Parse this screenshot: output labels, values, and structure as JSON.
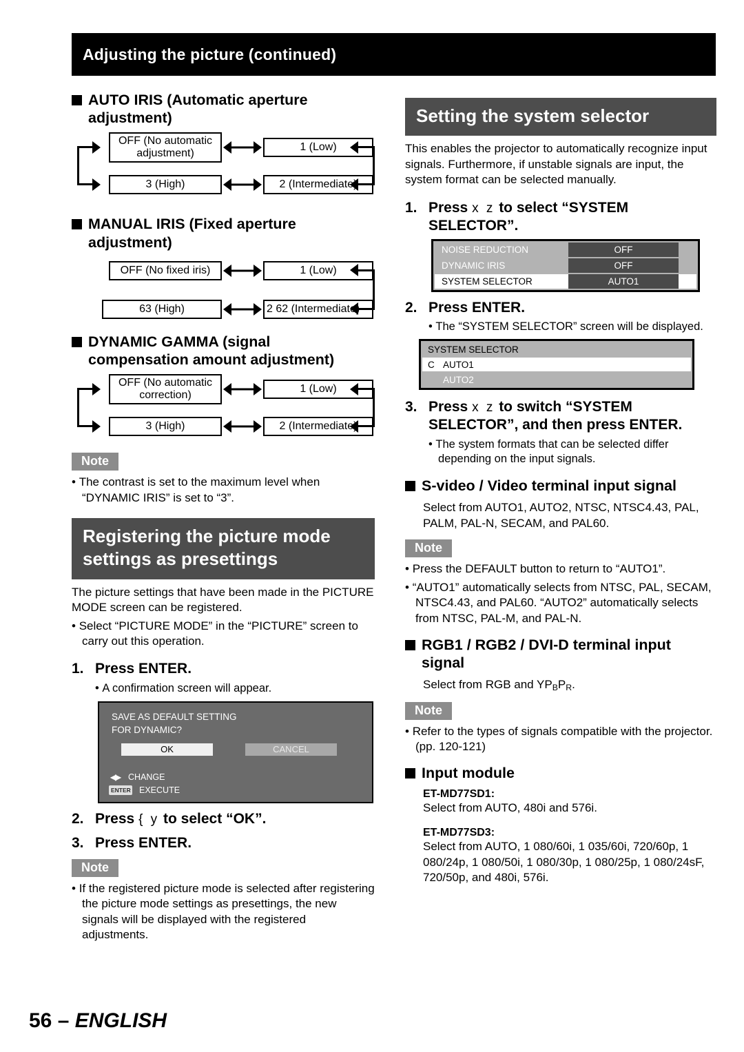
{
  "header": {
    "title": "Adjusting the picture (continued)"
  },
  "footer": {
    "page": "56",
    "dash": "–",
    "language": "ENGLISH"
  },
  "left": {
    "auto_iris": {
      "heading": "AUTO IRIS (Automatic aperture adjustment)",
      "boxes": {
        "off": "OFF (No automatic adjustment)",
        "low": "1 (Low)",
        "high": "3 (High)",
        "intermediate": "2 (Intermediate)"
      }
    },
    "manual_iris": {
      "heading": "MANUAL IRIS (Fixed aperture adjustment)",
      "boxes": {
        "off": "OFF (No fixed iris)",
        "low": "1 (Low)",
        "high": "63 (High)",
        "intermediate": "2   62 (Intermediate)"
      }
    },
    "dynamic_gamma": {
      "heading": "DYNAMIC GAMMA (signal compensation amount adjustment)",
      "boxes": {
        "off": "OFF (No automatic correction)",
        "low": "1 (Low)",
        "high": "3 (High)",
        "intermediate": "2 (Intermediate)"
      }
    },
    "note1": {
      "tag": "Note",
      "items": [
        "The contrast is set to the maximum level when “DYNAMIC IRIS” is set to “3”."
      ]
    },
    "register": {
      "banner": "Registering the picture mode settings as presettings",
      "intro": "The picture settings that have been made in the PICTURE MODE screen can be registered.",
      "intro_bullet": "Select “PICTURE MODE” in the “PICTURE” screen to carry out this operation.",
      "step1_num": "1.",
      "step1_text": "Press ENTER.",
      "step1_sub": "A confirmation screen will appear.",
      "dialog": {
        "line1": "SAVE AS DEFAULT SETTING",
        "line2": "FOR DYNAMIC?",
        "ok": "OK",
        "cancel": "CANCEL",
        "change_label": "CHANGE",
        "execute_label": "EXECUTE",
        "enter_key": "ENTER",
        "lr_icon": "◀▶"
      },
      "step2_num": "2.",
      "step2_pre": "Press",
      "step2_keys": "{ y",
      "step2_post": "to select “OK”.",
      "step3_num": "3.",
      "step3_text": "Press ENTER."
    },
    "note2": {
      "tag": "Note",
      "items": [
        "If the registered picture mode is selected after registering the picture mode settings as presettings, the new signals will be displayed with the registered adjustments."
      ]
    }
  },
  "right": {
    "system_selector": {
      "banner": "Setting the system selector",
      "intro": "This enables the projector to automatically recognize input signals. Furthermore, if unstable signals are input, the system format can be selected manually.",
      "step1_num": "1.",
      "step1_pre": "Press",
      "step1_keys": "x z",
      "step1_post": "to select “SYSTEM SELECTOR”.",
      "menu1": {
        "rows": [
          {
            "label": "NOISE REDUCTION",
            "value": "OFF",
            "selected": false
          },
          {
            "label": "DYNAMIC IRIS",
            "value": "OFF",
            "selected": false
          },
          {
            "label": "SYSTEM SELECTOR",
            "value": "AUTO1",
            "selected": true
          }
        ]
      },
      "step2_num": "2.",
      "step2_text": "Press ENTER.",
      "step2_sub": "The “SYSTEM SELECTOR” screen will be displayed.",
      "menu2": {
        "title": "SYSTEM SELECTOR",
        "items": [
          {
            "mark": "C",
            "label": "AUTO1",
            "current": true
          },
          {
            "mark": "",
            "label": "AUTO2",
            "current": false
          }
        ]
      },
      "step3_num": "3.",
      "step3_pre": "Press",
      "step3_keys": "x z",
      "step3_post": "to switch “SYSTEM SELECTOR”, and then press ENTER.",
      "step3_sub": "The system formats that can be selected differ depending on the input signals."
    },
    "svideo": {
      "heading": "S-video / Video terminal input signal",
      "text": "Select from AUTO1, AUTO2, NTSC, NTSC4.43, PAL, PALM, PAL-N, SECAM, and PAL60."
    },
    "note1": {
      "tag": "Note",
      "items": [
        "Press the DEFAULT button to return to “AUTO1”.",
        "“AUTO1” automatically selects from NTSC, PAL, SECAM, NTSC4.43, and PAL60. “AUTO2” automatically selects from NTSC, PAL-M, and PAL-N."
      ]
    },
    "rgb": {
      "heading": "RGB1 / RGB2 / DVI-D terminal input signal",
      "text_pre": "Select from RGB and YP",
      "text_sub1": "B",
      "text_mid": "P",
      "text_sub2": "R",
      "text_post": "."
    },
    "note2": {
      "tag": "Note",
      "items": [
        "Refer to the types of signals compatible with the projector. (pp. 120-121)"
      ]
    },
    "input_module": {
      "heading": "Input module",
      "sd1_label": "ET-MD77SD1:",
      "sd1_text": "Select from AUTO, 480i and 576i.",
      "sd3_label": "ET-MD77SD3:",
      "sd3_text": "Select from AUTO, 1 080/60i, 1 035/60i, 720/60p, 1 080/24p, 1 080/50i, 1 080/30p, 1 080/25p, 1 080/24sF, 720/50p, and 480i, 576i."
    }
  }
}
